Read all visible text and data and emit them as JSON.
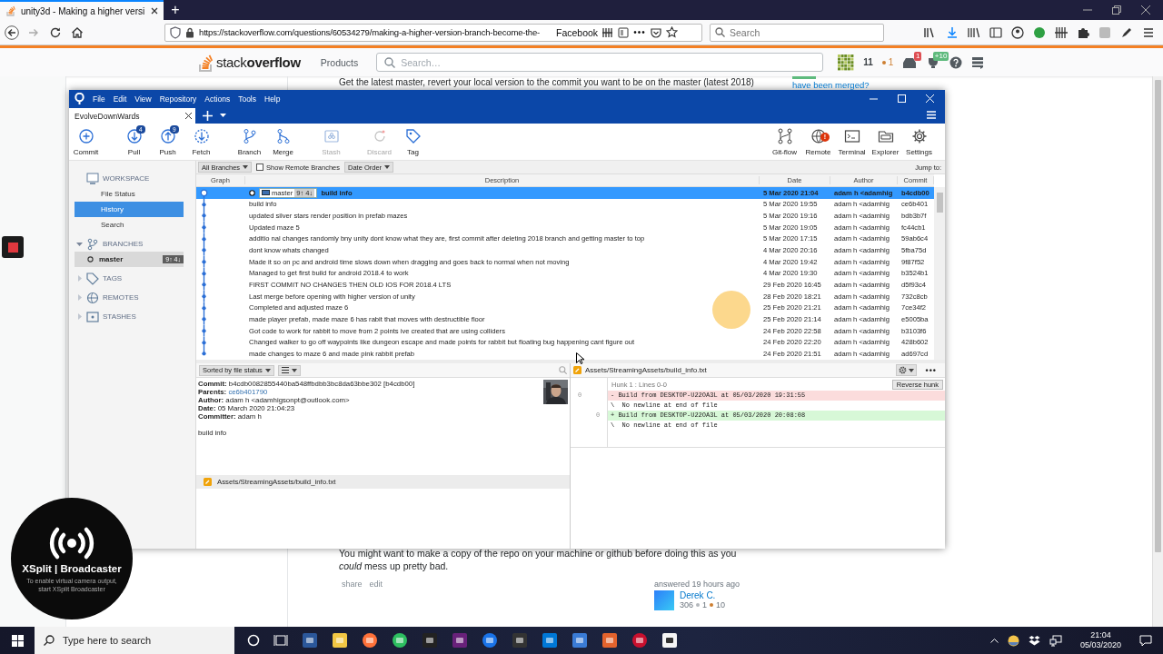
{
  "browser": {
    "tab": {
      "title": "unity3d - Making a higher versi",
      "selected": true
    },
    "new_tab": "+",
    "url": "https://stackoverflow.com/questions/60534279/making-a-higher-version-branch-become-the-",
    "bookmark": "Facebook",
    "more": "•••",
    "search_placeholder": "Search"
  },
  "page": {
    "logo": "stack**overflow**",
    "nav": "Products",
    "search_placeholder": "Search…",
    "reputation": "11",
    "bronze": "1",
    "inbox_count": "1",
    "achievements": "+10",
    "answer_top": "Get the latest master, revert your local version to the commit you want to be on the master (latest 2018)",
    "sidebar_link": "have been merged?",
    "answer_text": "You might want to make a copy of the repo on your machine or github before doing this as you *could* mess up pretty bad.",
    "actions": [
      "share",
      "edit"
    ],
    "answered": "answered 19 hours ago",
    "user": {
      "name": "Derek C.",
      "reputation": "306",
      "silver": "1",
      "bronze": "10"
    }
  },
  "sourcetree": {
    "menu": [
      "File",
      "Edit",
      "View",
      "Repository",
      "Actions",
      "Tools",
      "Help"
    ],
    "tabs": [
      {
        "label": "EvolveDownWards",
        "selected": true
      }
    ],
    "toolbar": [
      {
        "label": "Commit",
        "disabled": false
      },
      {
        "label": "Pull",
        "badge": "4",
        "disabled": false
      },
      {
        "label": "Push",
        "badge": "9",
        "disabled": false
      },
      {
        "label": "Fetch",
        "disabled": false
      },
      {
        "label": "Branch",
        "disabled": false
      },
      {
        "label": "Merge",
        "disabled": false
      },
      {
        "label": "Stash",
        "disabled": true
      },
      {
        "label": "Discard",
        "disabled": true
      },
      {
        "label": "Tag",
        "disabled": false
      }
    ],
    "toolbar_right": [
      {
        "label": "Git-flow"
      },
      {
        "label": "Remote",
        "alert": "!"
      },
      {
        "label": "Terminal"
      },
      {
        "label": "Explorer"
      },
      {
        "label": "Settings"
      }
    ],
    "filters": {
      "branches": "All Branches",
      "show_remote": {
        "label": "Show Remote Branches",
        "checked": false
      },
      "order": "Date Order",
      "jump": "Jump to:"
    },
    "sidebar": [
      {
        "title": "WORKSPACE",
        "items": [
          {
            "label": "File Status",
            "selected": false
          },
          {
            "label": "History",
            "selected": true
          },
          {
            "label": "Search",
            "selected": false
          }
        ]
      },
      {
        "title": "BRANCHES",
        "expanded": true,
        "items": [
          {
            "label": "master",
            "badge": "9↑ 4↓",
            "selected": true
          }
        ]
      },
      {
        "title": "TAGS",
        "expanded": false
      },
      {
        "title": "REMOTES",
        "expanded": false
      },
      {
        "title": "STASHES",
        "expanded": false
      }
    ],
    "history": {
      "columns": [
        "Graph",
        "Description",
        "Date",
        "Author",
        "Commit"
      ],
      "rows": [
        {
          "description": "build info",
          "branch": {
            "name": "master",
            "status": "9↑ 4↓"
          },
          "date": "5 Mar 2020 21:04",
          "author": "adam h <adamhig",
          "commit": "b4cdb00",
          "selected": true
        },
        {
          "description": "build info",
          "date": "5 Mar 2020 19:55",
          "author": "adam h <adamhig",
          "commit": "ce6b401",
          "selected": false
        },
        {
          "description": "updated silver stars render position in prefab mazes",
          "date": "5 Mar 2020 19:16",
          "author": "adam h <adamhig",
          "commit": "bdb3b7f",
          "selected": false
        },
        {
          "description": "Updated maze 5",
          "date": "5 Mar 2020 19:05",
          "author": "adam h <adamhig",
          "commit": "fc44cb1",
          "selected": false
        },
        {
          "description": "additio nal changes randomly bny unity dont know what they are, first commit after deleting 2018 branch and getting master to top",
          "date": "5 Mar 2020 17:15",
          "author": "adam h <adamhig",
          "commit": "59ab6c4",
          "selected": false
        },
        {
          "description": "dont know whats changed",
          "date": "4 Mar 2020 20:16",
          "author": "adam h <adamhig",
          "commit": "5fba75d",
          "selected": false
        },
        {
          "description": "Made it so on pc and android time slows down when dragging and goes back to normal when not moving",
          "date": "4 Mar 2020 19:42",
          "author": "adam h <adamhig",
          "commit": "9f87f52",
          "selected": false
        },
        {
          "description": "Managed to get first build for android 2018.4 to work",
          "date": "4 Mar 2020 19:30",
          "author": "adam h <adamhig",
          "commit": "b3524b1",
          "selected": false
        },
        {
          "description": "FIRST COMMIT NO CHANGES THEN OLD IOS FOR 2018.4 LTS",
          "date": "29 Feb 2020 16:45",
          "author": "adam h <adamhig",
          "commit": "d5f93c4",
          "selected": false
        },
        {
          "description": "Last merge before opening with higher version of unity",
          "date": "28 Feb 2020 18:21",
          "author": "adam h <adamhig",
          "commit": "732c8cb",
          "selected": false
        },
        {
          "description": "Completed and adjusted maze 6",
          "date": "25 Feb 2020 21:21",
          "author": "adam h <adamhig",
          "commit": "7ce34f2",
          "selected": false
        },
        {
          "description": "made player prefab, made maze 6 has rabit that moves with destructible floor",
          "date": "25 Feb 2020 21:14",
          "author": "adam h <adamhig",
          "commit": "e5005ba",
          "selected": false
        },
        {
          "description": "Got code to work for rabbit to move from 2 points ive created that are using colliders",
          "date": "24 Feb 2020 22:58",
          "author": "adam h <adamhig",
          "commit": "b3103f6",
          "selected": false
        },
        {
          "description": "Changed walker to go off waypoints like dungeon escape and made points for rabbit but floating bug happening cant figure out",
          "date": "24 Feb 2020 22:20",
          "author": "adam h <adamhig",
          "commit": "428b602",
          "selected": false
        },
        {
          "description": "made changes to maze 6 and made pink rabbit prefab",
          "date": "24 Feb 2020 21:51",
          "author": "adam h <adamhig",
          "commit": "ad697cd",
          "selected": false
        }
      ]
    },
    "details": {
      "sort": "Sorted by file status",
      "fields": [
        {
          "label": "Commit:",
          "value": "b4cdb0082855440ba548ffbdbb3bc8da63bbe302 [b4cdb00]",
          "kind": "text"
        },
        {
          "label": "Parents:",
          "value": "ce6b401790",
          "kind": "link"
        },
        {
          "label": "Author:",
          "value": "adam h <adamhigsonpt@outlook.com>",
          "kind": "text"
        },
        {
          "label": "Date:",
          "value": "05 March 2020 21:04:23",
          "kind": "text"
        },
        {
          "label": "Committer:",
          "value": "adam h",
          "kind": "text"
        }
      ],
      "message": "build info",
      "files": [
        "Assets/StreamingAssets/build_info.txt"
      ]
    },
    "diff": {
      "file": "Assets/StreamingAssets/build_info.txt",
      "more": "•••",
      "hunk": "Hunk 1 : Lines 0-0",
      "reverse": "Reverse hunk",
      "lines": [
        {
          "kind": "removed",
          "old": "0",
          "text": "- Build from DESKTOP-U22OA3L at 05/03/2020 19:31:55"
        },
        {
          "kind": "context",
          "text": "\\  No newline at end of file"
        },
        {
          "kind": "added",
          "new": "0",
          "text": "+ Build from DESKTOP-U22OA3L at 05/03/2020 20:08:08"
        },
        {
          "kind": "context",
          "text": "\\  No newline at end of file"
        }
      ]
    }
  },
  "xsplit": {
    "title": "XSplit | Broadcaster",
    "caption": "To enable virtual camera output, start XSplit Broadcaster"
  },
  "taskbar": {
    "search_placeholder": "Type here to search",
    "time": "21:04",
    "date": "05/03/2020"
  }
}
